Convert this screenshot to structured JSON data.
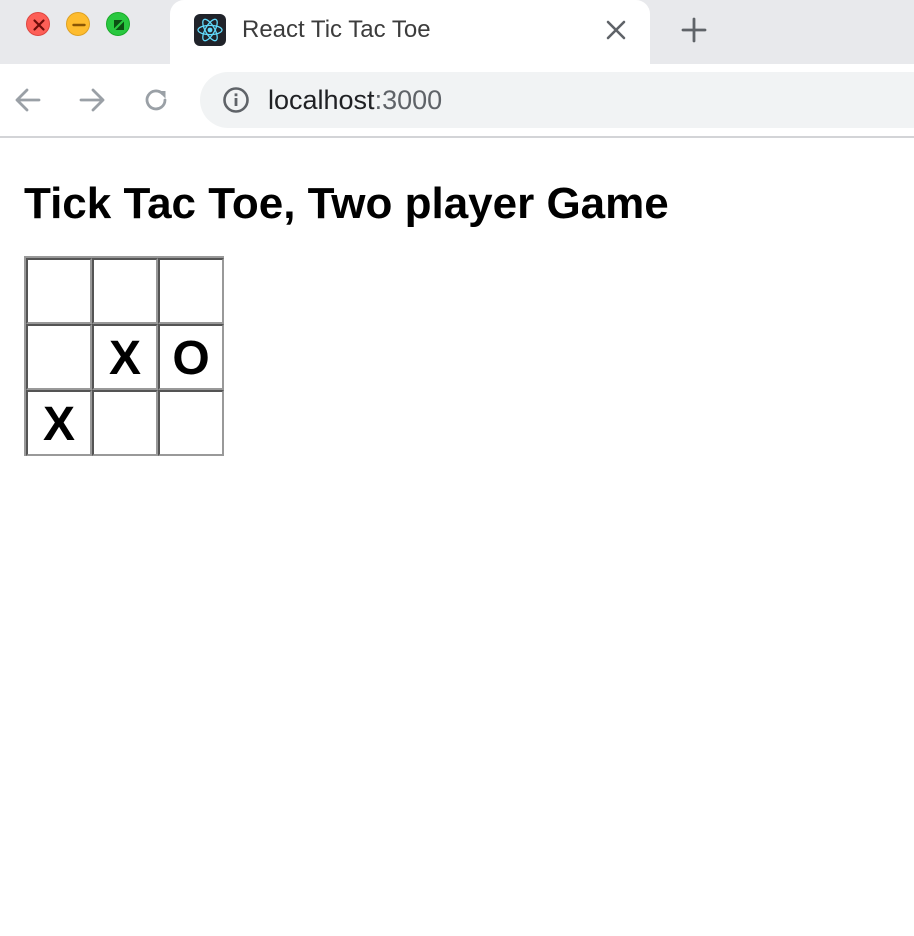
{
  "browser": {
    "tab": {
      "title": "React Tic Tac Toe",
      "favicon": "react-logo-icon"
    },
    "toolbar": {
      "url_host": "localhost",
      "url_port": ":3000"
    },
    "colors": {
      "tabstrip": "#e8e9ec",
      "omnibox": "#f1f3f4",
      "react_cyan": "#61dafb"
    }
  },
  "page": {
    "title": "Tick Tac Toe, Two player Game",
    "board": {
      "squares": [
        "",
        "",
        "",
        "",
        "X",
        "O",
        "X",
        "",
        ""
      ]
    }
  }
}
